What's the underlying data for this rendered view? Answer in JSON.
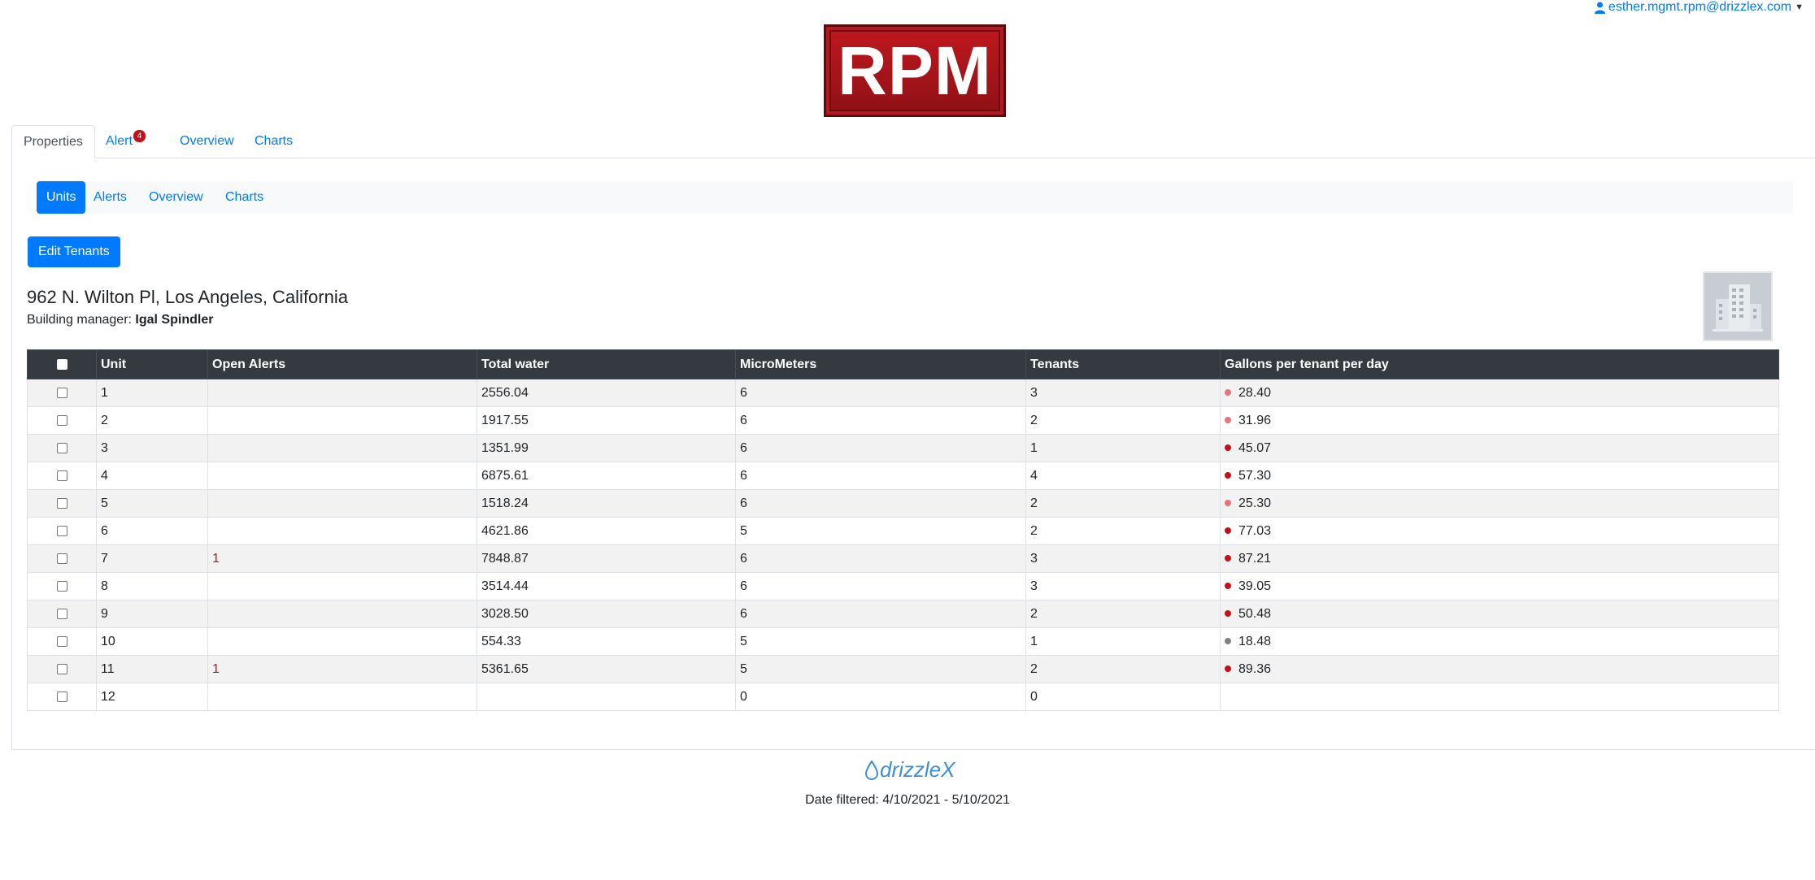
{
  "user": {
    "email": "esther.mgmt.rpm@drizzlex.com"
  },
  "brand": {
    "logo_text": "RPM"
  },
  "top_tabs": [
    {
      "label": "Properties"
    },
    {
      "label": "Alert",
      "badge": "4"
    },
    {
      "label": "Overview"
    },
    {
      "label": "Charts"
    }
  ],
  "sub_tabs": [
    {
      "label": "Units"
    },
    {
      "label": "Alerts"
    },
    {
      "label": "Overview"
    },
    {
      "label": "Charts"
    }
  ],
  "actions": {
    "edit_tenants": "Edit Tenants"
  },
  "property": {
    "address": "962 N. Wilton Pl, Los Angeles, California",
    "manager_label": "Building manager:",
    "manager_name": "Igal Spindler"
  },
  "table": {
    "headers": [
      "Unit",
      "Open Alerts",
      "Total water",
      "MicroMeters",
      "Tenants",
      "Gallons per tenant per day"
    ],
    "rows": [
      {
        "unit": "1",
        "open_alerts": "",
        "total_water": "2556.04",
        "micrometers": "6",
        "tenants": "3",
        "gpd": "28.40",
        "dot_color": "#e8747a"
      },
      {
        "unit": "2",
        "open_alerts": "",
        "total_water": "1917.55",
        "micrometers": "6",
        "tenants": "2",
        "gpd": "31.96",
        "dot_color": "#e8747a"
      },
      {
        "unit": "3",
        "open_alerts": "",
        "total_water": "1351.99",
        "micrometers": "6",
        "tenants": "1",
        "gpd": "45.07",
        "dot_color": "#c0121b"
      },
      {
        "unit": "4",
        "open_alerts": "",
        "total_water": "6875.61",
        "micrometers": "6",
        "tenants": "4",
        "gpd": "57.30",
        "dot_color": "#c0121b"
      },
      {
        "unit": "5",
        "open_alerts": "",
        "total_water": "1518.24",
        "micrometers": "6",
        "tenants": "2",
        "gpd": "25.30",
        "dot_color": "#e8747a"
      },
      {
        "unit": "6",
        "open_alerts": "",
        "total_water": "4621.86",
        "micrometers": "5",
        "tenants": "2",
        "gpd": "77.03",
        "dot_color": "#c0121b"
      },
      {
        "unit": "7",
        "open_alerts": "1",
        "total_water": "7848.87",
        "micrometers": "6",
        "tenants": "3",
        "gpd": "87.21",
        "dot_color": "#c0121b"
      },
      {
        "unit": "8",
        "open_alerts": "",
        "total_water": "3514.44",
        "micrometers": "6",
        "tenants": "3",
        "gpd": "39.05",
        "dot_color": "#c0121b"
      },
      {
        "unit": "9",
        "open_alerts": "",
        "total_water": "3028.50",
        "micrometers": "6",
        "tenants": "2",
        "gpd": "50.48",
        "dot_color": "#c0121b"
      },
      {
        "unit": "10",
        "open_alerts": "",
        "total_water": "554.33",
        "micrometers": "5",
        "tenants": "1",
        "gpd": "18.48",
        "dot_color": "#808080"
      },
      {
        "unit": "11",
        "open_alerts": "1",
        "total_water": "5361.65",
        "micrometers": "5",
        "tenants": "2",
        "gpd": "89.36",
        "dot_color": "#c0121b"
      },
      {
        "unit": "12",
        "open_alerts": "",
        "total_water": "",
        "micrometers": "0",
        "tenants": "0",
        "gpd": "",
        "dot_color": ""
      }
    ]
  },
  "footer": {
    "brand": "drizzleX",
    "date_filter": "Date filtered: 4/10/2021 - 5/10/2021"
  },
  "icons": {
    "user": "user-icon",
    "caret": "caret-down-icon",
    "building": "building-icon",
    "drop": "water-drop-icon"
  }
}
